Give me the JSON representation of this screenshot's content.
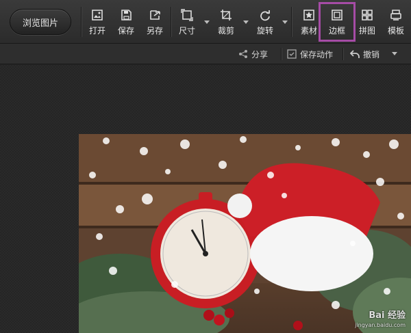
{
  "toolbar": {
    "browse_label": "浏览图片",
    "tools": [
      {
        "id": "open",
        "label": "打开",
        "icon": "open-icon"
      },
      {
        "id": "save",
        "label": "保存",
        "icon": "save-icon"
      },
      {
        "id": "save_as",
        "label": "另存",
        "icon": "save-as-icon"
      },
      {
        "id": "size",
        "label": "尺寸",
        "icon": "resize-icon"
      },
      {
        "id": "crop",
        "label": "裁剪",
        "icon": "crop-icon"
      },
      {
        "id": "rotate",
        "label": "旋转",
        "icon": "rotate-icon"
      },
      {
        "id": "material",
        "label": "素材",
        "icon": "star-icon"
      },
      {
        "id": "border",
        "label": "边框",
        "icon": "border-icon"
      },
      {
        "id": "collage",
        "label": "拼图",
        "icon": "grid-icon"
      },
      {
        "id": "template",
        "label": "模板",
        "icon": "template-icon"
      }
    ],
    "highlight_color": "#a64ca6"
  },
  "subbar": {
    "share_label": "分享",
    "save_action_label": "保存动作",
    "undo_label": "撤销"
  },
  "watermark": {
    "brand": "Bai 经验",
    "url": "jingyan.baidu.com"
  }
}
